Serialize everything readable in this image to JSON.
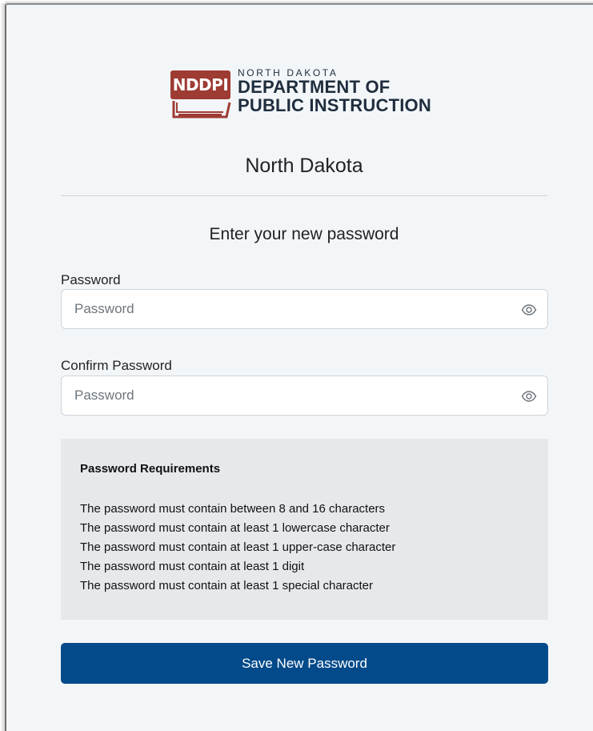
{
  "logo": {
    "badge_text": "NDDPI",
    "line_small": "NORTH DAKOTA",
    "line_big1": "DEPARTMENT OF",
    "line_big2": "PUBLIC INSTRUCTION",
    "brand_color": "#9e3b33"
  },
  "site_title": "North Dakota",
  "form_heading": "Enter your new password",
  "fields": {
    "password": {
      "label": "Password",
      "placeholder": "Password",
      "value": "",
      "icon": "eye-icon"
    },
    "confirm_password": {
      "label": "Confirm Password",
      "placeholder": "Password",
      "value": "",
      "icon": "eye-icon"
    }
  },
  "requirements": {
    "title": "Password Requirements",
    "items": [
      "The password must contain between 8 and 16 characters",
      "The password must contain at least 1 lowercase character",
      "The password must contain at least 1 upper-case character",
      "The password must contain at least 1 digit",
      "The password must contain at least 1 special character"
    ]
  },
  "save_button": {
    "label": "Save New Password",
    "color": "#034a8a"
  }
}
